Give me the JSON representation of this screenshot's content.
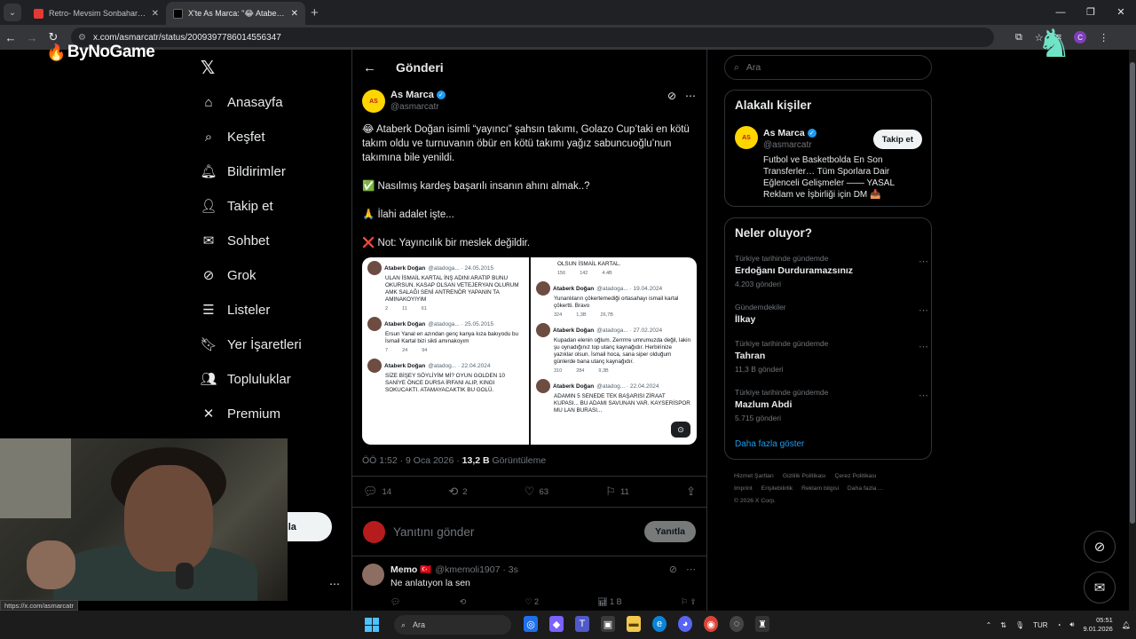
{
  "browser": {
    "tabs": [
      {
        "title": "Retro- Mevsim Sonbahar X MV...",
        "color": "#e53935"
      },
      {
        "title": "X'te As Marca: \"😂 Ataberk Doğ...",
        "color": "#e7e9ea"
      }
    ],
    "url": "x.com/asmarcatr/status/2009397786014556347",
    "profile_letter": "C"
  },
  "overlay": {
    "watermark": "ByNoGame"
  },
  "nav": {
    "logo": "𝕏",
    "items": [
      {
        "label": "Anasayfa",
        "icon": "home-icon"
      },
      {
        "label": "Keşfet",
        "icon": "search-icon"
      },
      {
        "label": "Bildirimler",
        "icon": "bell-icon"
      },
      {
        "label": "Takip et",
        "icon": "person-add-icon"
      },
      {
        "label": "Sohbet",
        "icon": "mail-icon"
      },
      {
        "label": "Grok",
        "icon": "grok-icon"
      },
      {
        "label": "Listeler",
        "icon": "list-icon"
      },
      {
        "label": "Yer İşaretleri",
        "icon": "bookmark-icon"
      },
      {
        "label": "Topluluklar",
        "icon": "people-icon"
      },
      {
        "label": "Premium",
        "icon": "x-icon"
      }
    ],
    "post_button": "nla"
  },
  "main": {
    "header_title": "Gönderi",
    "post": {
      "author": "As Marca",
      "handle": "@asmarcatr",
      "avatar_text": "AS",
      "paragraphs": [
        "😂 Ataberk Doğan isimli “yayıncı” şahsın takımı, Golazo Cup’taki en kötü takım oldu ve turnuvanın öbür en kötü takımı yağız sabuncuoğlu’nun takımına bile yenildi.",
        "✅ Nasılmış kardeş başarılı insanın ahını almak..?",
        "🙏 İlahi adalet işte...",
        "❌ Not: Yayıncılık bir meslek değildir."
      ],
      "time": "ÖÖ 1:52 · 9 Oca 2026 ·",
      "views": "13,2 B",
      "views_label": "Görüntüleme",
      "stats": {
        "replies": "14",
        "reposts": "2",
        "likes": "63",
        "bookmarks": "11"
      }
    },
    "media": {
      "left": [
        {
          "name": "Ataberk Doğan",
          "meta": "@atadoga... · 24.05.2015",
          "text": "ULAN İSMAİL KARTAL İNŞ ADINI ARATIP BUNU OKURSUN. KASAP OLSAN VETEJERYAN OLURUM AMK SALAĞI SENİ ANTRENÖR YAPANIN TA AMINAKOYIYIM",
          "s": [
            "2",
            "11",
            "61"
          ]
        },
        {
          "name": "Ataberk Doğan",
          "meta": "@atadoga... · 25.05.2015",
          "text": "Ersun Yanal en azından genç kanya kıza bakıyodu bu İsmail Kartal bizi sikti amınakoyım",
          "s": [
            "7",
            "24",
            "94"
          ]
        },
        {
          "name": "Ataberk Doğan",
          "meta": "@atadog... · 22.04.2024",
          "text": "SİZE BİŞEY SÖYLİYİM Mİ? OYUN GOLDEN 10 SANİYE ÖNCE DURSA İRFANI ALIP, KINGI SOKUCAKTI. ATAMAYACAKTIK BU GOLÜ.",
          "s": [
            "",
            "",
            ""
          ]
        }
      ],
      "right": [
        {
          "name": "",
          "meta": "",
          "text": "OLSUN İSMAİL KARTAL.",
          "s": [
            "156",
            "142",
            "4.4B"
          ]
        },
        {
          "name": "Ataberk Doğan",
          "meta": "@atadoga... · 19.04.2024",
          "text": "Yunanlıların çökertemediği ortasahayı ismail kartal çökertti. Bravo",
          "s": [
            "324",
            "1,3B",
            "26,7B"
          ]
        },
        {
          "name": "Ataberk Doğan",
          "meta": "@atadoga... · 27.02.2024",
          "text": "Kupadan elenin oğlum. Zerrrrre umrumuzda değil, lakin şu oynadığınız top utanç kaynağıdır. Herbirinize yazıklar olsun. İsmail hoca, sana siper olduğum günlerde bana utanç kaynağıdır.",
          "s": [
            "310",
            "284",
            "9,3B"
          ]
        },
        {
          "name": "Ataberk Doğan",
          "meta": "@atadog... · 22.04.2024",
          "text": "ADAMIN 5 SENEDE TEK BAŞARISI ZİRAAT KUPASI... BU ADAMI SAVUNAN VAR. KAYSERİSPOR MU LAN BURASI...",
          "s": [
            "",
            "",
            ""
          ]
        }
      ]
    },
    "reply": {
      "placeholder": "Yanıtını gönder",
      "button": "Yanıtla"
    },
    "reply_tweet": {
      "name": "Memo 🇹🇷",
      "handle": "@kmemoli1907 · 3s",
      "text": "Ne anlatıyon la sen",
      "likes": "2",
      "views": "1 B"
    }
  },
  "right": {
    "search_placeholder": "Ara",
    "related_title": "Alakalı kişiler",
    "related": {
      "name": "As Marca",
      "handle": "@asmarcatr",
      "follow": "Takip et",
      "bio": "Futbol ve Basketbolda En Son Transferler… Tüm Sporlara Dair Eğlenceli Gelişmeler —— YASAL Reklam ve İşbirliği için DM 📥"
    },
    "trends_title": "Neler oluyor?",
    "trends": [
      {
        "ctx": "Türkiye tarihinde gündemde",
        "title": "Erdoğanı Durduramazsınız",
        "count": "4.203 gönderi"
      },
      {
        "ctx": "Gündemdekiler",
        "title": "İlkay",
        "count": ""
      },
      {
        "ctx": "Türkiye tarihinde gündemde",
        "title": "Tahran",
        "count": "11,3 B gönderi"
      },
      {
        "ctx": "Türkiye tarihinde gündemde",
        "title": "Mazlum Abdi",
        "count": "5.715 gönderi"
      }
    ],
    "show_more": "Daha fazla göster",
    "footer": [
      "Hizmet Şartları",
      "Gizlilik Politikası",
      "Çerez Politikası",
      "Imprint",
      "Erişilebilirlik",
      "Reklam bilgisi",
      "Daha fazla ...",
      "© 2026 X Corp."
    ]
  },
  "status_link": "https://x.com/asmarcatr",
  "taskbar": {
    "search": "Ara",
    "lang": "TUR",
    "time": "05:51",
    "date": "9.01.2026"
  }
}
